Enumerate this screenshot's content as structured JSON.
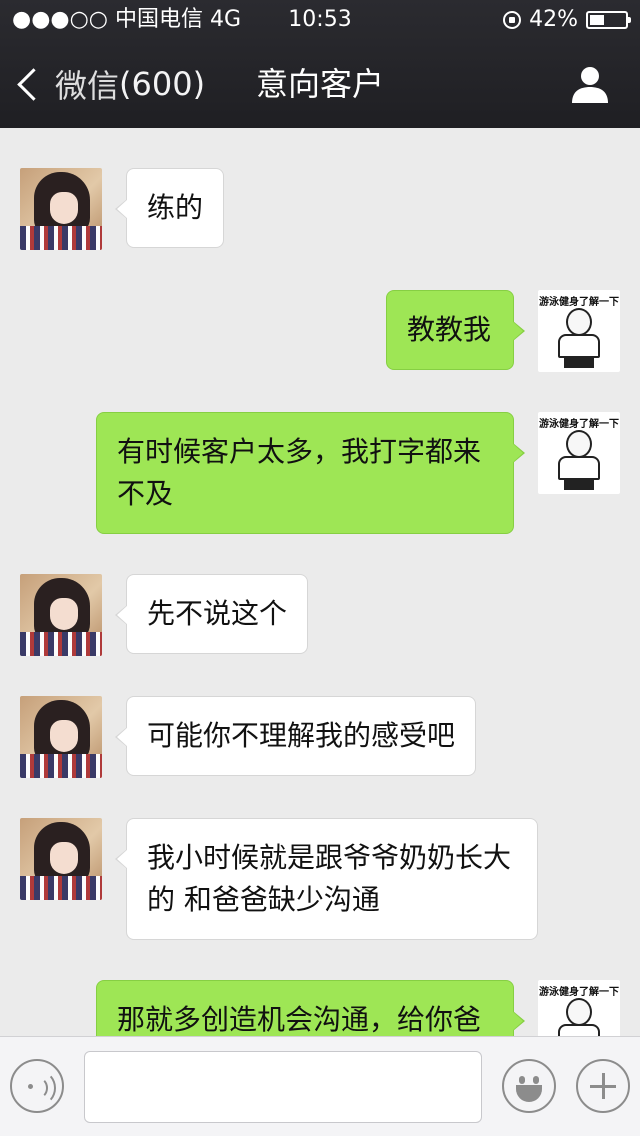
{
  "status_bar": {
    "signal": "●●●○○",
    "carrier": "中国电信",
    "network": "4G",
    "time": "10:53",
    "battery": "42%",
    "battery_level": 0.42
  },
  "nav": {
    "back_label": "微信",
    "unread_count": "(600)",
    "title": "意向客户"
  },
  "messages": [
    {
      "side": "left",
      "avatar": "girl-avatar",
      "text": "练的"
    },
    {
      "side": "right",
      "avatar": "meme-avatar",
      "text": "教教我"
    },
    {
      "side": "right",
      "avatar": "meme-avatar",
      "text": "有时候客户太多，我打字都来不及"
    },
    {
      "side": "left",
      "avatar": "girl-avatar",
      "text": "先不说这个"
    },
    {
      "side": "left",
      "avatar": "girl-avatar",
      "text": "可能你不理解我的感受吧"
    },
    {
      "side": "left",
      "avatar": "girl-avatar",
      "text": "我小时候就是跟爷爷奶奶长大的 和爸爸缺少沟通"
    },
    {
      "side": "right",
      "avatar": "meme-avatar",
      "text": "那就多创造机会沟通，给你爸"
    }
  ],
  "meme_caption": "游泳健身了解一下",
  "input_bar": {
    "value": "",
    "placeholder": ""
  },
  "colors": {
    "nav_bg": "#1f1f23",
    "chat_bg": "#ebebeb",
    "bubble_sent": "#9ee655",
    "bubble_received": "#ffffff"
  }
}
